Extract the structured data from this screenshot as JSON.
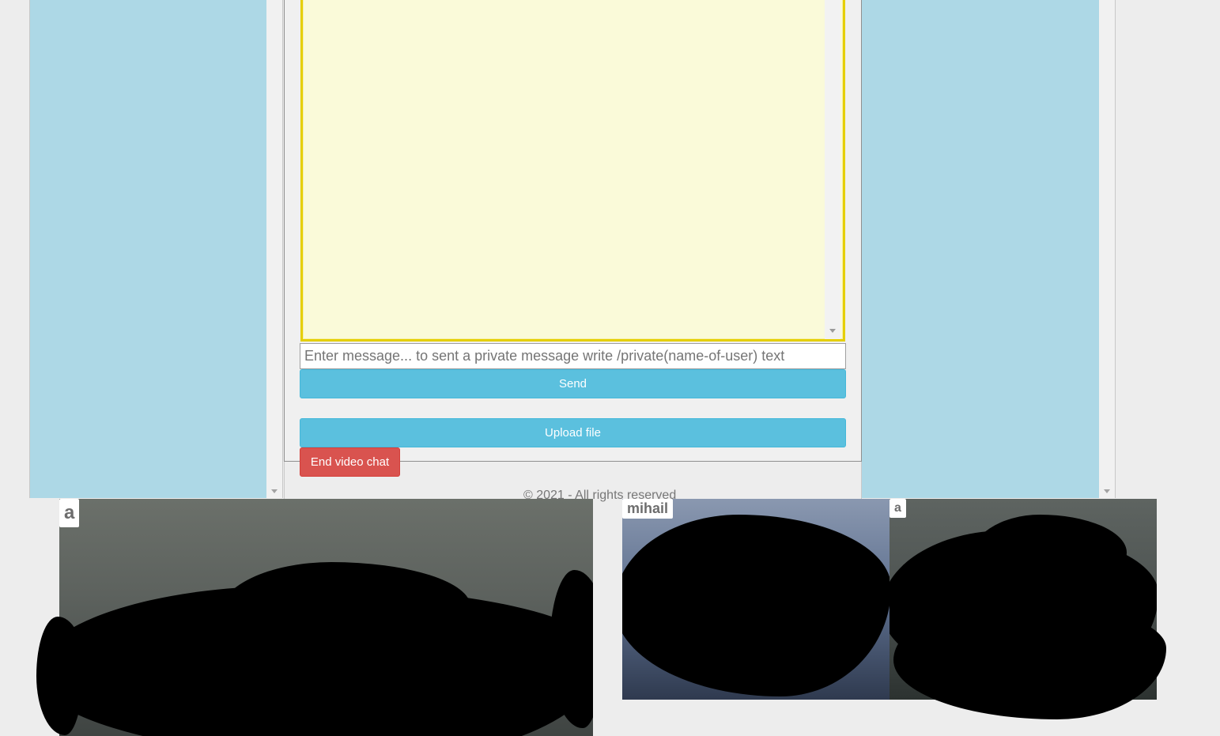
{
  "chat": {
    "input_placeholder": "Enter message... to sent a private message write /private(name-of-user) text",
    "send_label": "Send",
    "upload_label": "Upload file",
    "end_video_label": "End video chat"
  },
  "footer": {
    "text": "© 2021 - All rights reserved"
  },
  "videos": [
    {
      "user": "a"
    },
    {
      "user": "mihail"
    },
    {
      "user": "a"
    }
  ],
  "colors": {
    "side_panel": "#add8e6",
    "chat_log_bg": "#fafad9",
    "chat_log_border": "#e5cf00",
    "info_button": "#5bc0de",
    "danger_button": "#d9534f"
  }
}
